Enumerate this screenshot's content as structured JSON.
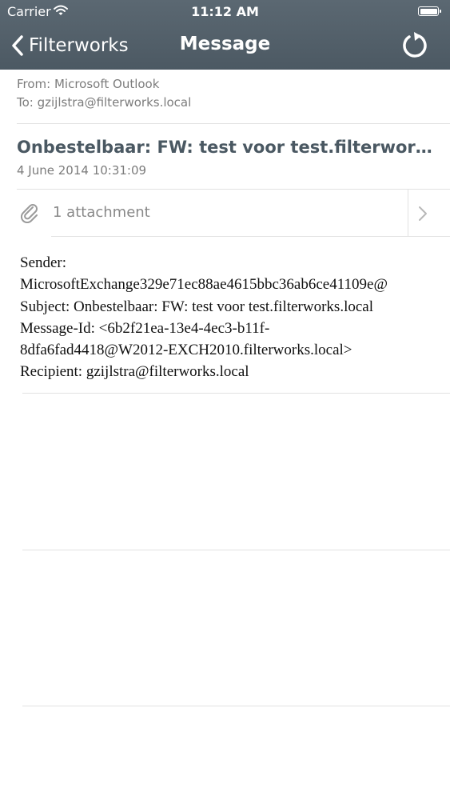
{
  "status": {
    "carrier": "Carrier",
    "time": "11:12 AM"
  },
  "nav": {
    "back_label": "Filterworks",
    "title": "Message"
  },
  "message": {
    "from": "From: Microsoft Outlook",
    "to": "To: gzijlstra@filterworks.local",
    "subject": "Onbestelbaar: FW: test voor test.filterworks.local",
    "date": "4 June 2014 10:31:09",
    "attachments_label": "1 attachment",
    "body_lines": [
      "Sender:",
      "MicrosoftExchange329e71ec88ae4615bbc36ab6ce41109e@",
      "Subject: Onbestelbaar: FW: test voor test.filterworks.local",
      "Message-Id: <6b2f21ea-13e4-4ec3-b11f-",
      "8dfa6fad4418@W2012-EXCH2010.filterworks.local>",
      "Recipient: gzijlstra@filterworks.local"
    ]
  },
  "icons": {
    "back": "chevron-left-icon",
    "refresh": "refresh-icon",
    "attachment": "paperclip-icon",
    "disclosure": "chevron-right-icon",
    "wifi": "wifi-icon",
    "battery": "battery-icon"
  },
  "colors": {
    "nav_bar": "#52606a",
    "subject": "#4a5862",
    "secondary_text": "#7c7c7c",
    "divider": "#e2e2e2"
  }
}
